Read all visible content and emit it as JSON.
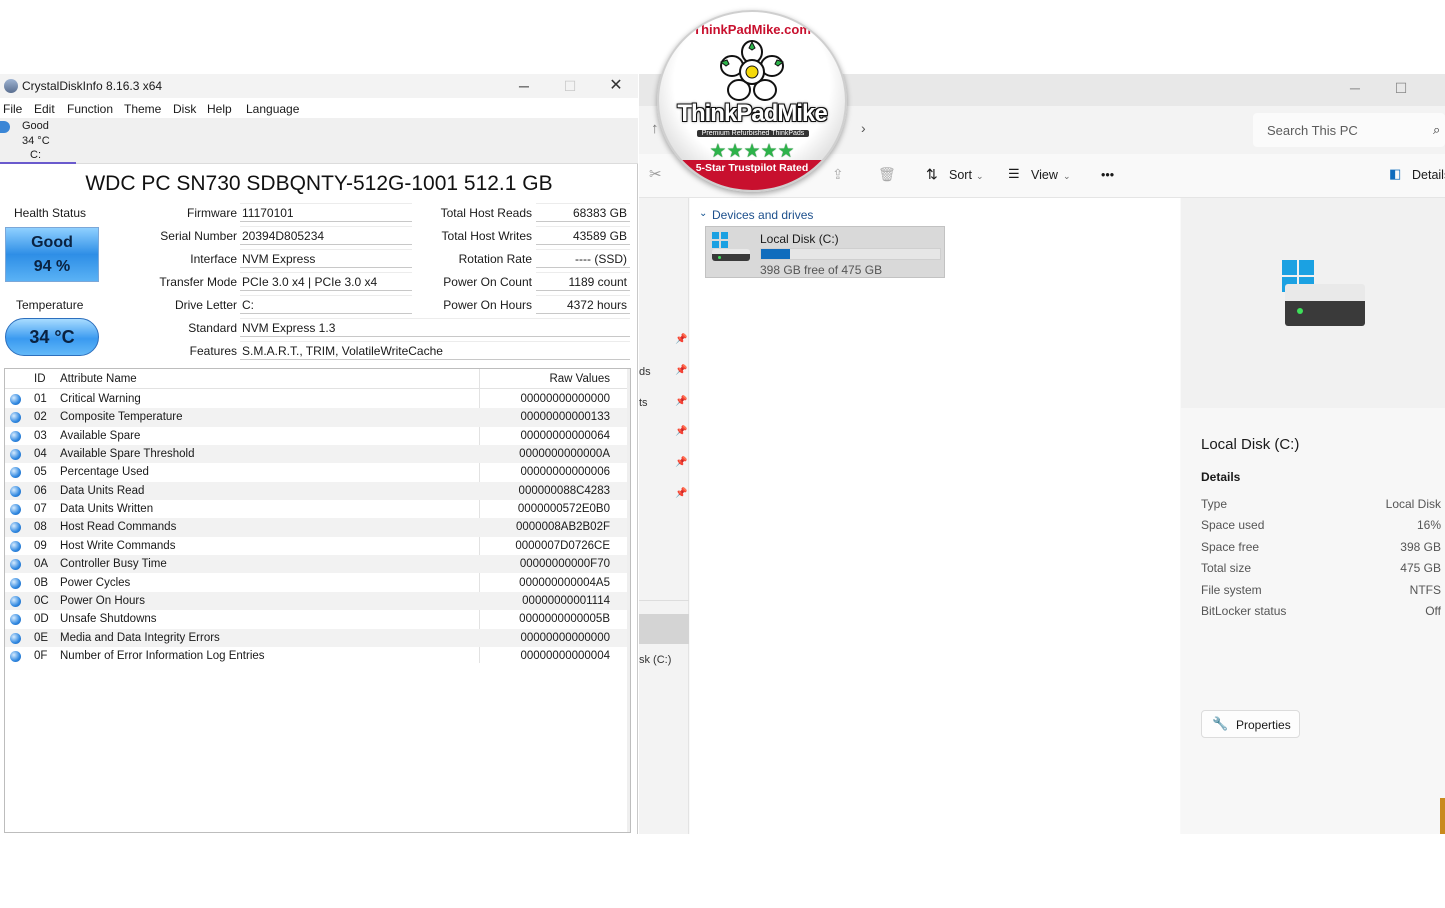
{
  "cdi": {
    "title": "CrystalDiskInfo 8.16.3 x64",
    "menu": [
      "File",
      "Edit",
      "Function",
      "Theme",
      "Disk",
      "Help",
      "Language"
    ],
    "tab": {
      "status": "Good",
      "temp": "34 °C",
      "letter": "C:"
    },
    "drive_title": "WDC PC SN730 SDBQNTY-512G-1001 512.1 GB",
    "health_status_label": "Health Status",
    "health_status": "Good",
    "health_percent": "94 %",
    "temperature_label": "Temperature",
    "temperature": "34 °C",
    "info": {
      "firmware_label": "Firmware",
      "firmware": "11170101",
      "serial_label": "Serial Number",
      "serial": "20394D805234",
      "interface_label": "Interface",
      "interface": "NVM Express",
      "transfer_label": "Transfer Mode",
      "transfer": "PCIe 3.0 x4 | PCIe 3.0 x4",
      "drive_letter_label": "Drive Letter",
      "drive_letter": "C:",
      "standard_label": "Standard",
      "standard": "NVM Express 1.3",
      "features_label": "Features",
      "features": "S.M.A.R.T., TRIM, VolatileWriteCache",
      "total_host_reads_label": "Total Host Reads",
      "total_host_reads": "68383 GB",
      "total_host_writes_label": "Total Host Writes",
      "total_host_writes": "43589 GB",
      "rotation_rate_label": "Rotation Rate",
      "rotation_rate": "---- (SSD)",
      "power_on_count_label": "Power On Count",
      "power_on_count": "1189 count",
      "power_on_hours_label": "Power On Hours",
      "power_on_hours": "4372 hours"
    },
    "attributes_header": {
      "id": "ID",
      "name": "Attribute Name",
      "raw": "Raw Values"
    },
    "attributes": [
      {
        "id": "01",
        "name": "Critical Warning",
        "raw": "00000000000000"
      },
      {
        "id": "02",
        "name": "Composite Temperature",
        "raw": "00000000000133"
      },
      {
        "id": "03",
        "name": "Available Spare",
        "raw": "00000000000064"
      },
      {
        "id": "04",
        "name": "Available Spare Threshold",
        "raw": "0000000000000A"
      },
      {
        "id": "05",
        "name": "Percentage Used",
        "raw": "00000000000006"
      },
      {
        "id": "06",
        "name": "Data Units Read",
        "raw": "000000088C4283"
      },
      {
        "id": "07",
        "name": "Data Units Written",
        "raw": "0000000572E0B0"
      },
      {
        "id": "08",
        "name": "Host Read Commands",
        "raw": "0000008AB2B02F"
      },
      {
        "id": "09",
        "name": "Host Write Commands",
        "raw": "0000007D0726CE"
      },
      {
        "id": "0A",
        "name": "Controller Busy Time",
        "raw": "00000000000F70"
      },
      {
        "id": "0B",
        "name": "Power Cycles",
        "raw": "000000000004A5"
      },
      {
        "id": "0C",
        "name": "Power On Hours",
        "raw": "00000000001114"
      },
      {
        "id": "0D",
        "name": "Unsafe Shutdowns",
        "raw": "0000000000005B"
      },
      {
        "id": "0E",
        "name": "Media and Data Integrity Errors",
        "raw": "00000000000000"
      },
      {
        "id": "0F",
        "name": "Number of Error Information Log Entries",
        "raw": "00000000000004"
      }
    ]
  },
  "explorer": {
    "search_placeholder": "Search This PC",
    "toolbar": {
      "sort": "Sort",
      "view": "View",
      "more": "•••",
      "details": "Details"
    },
    "nav_fragments": [
      "ds",
      "ts",
      "sk (C:)"
    ],
    "section_title": "Devices and drives",
    "drive": {
      "name": "Local Disk (C:)",
      "free": "398 GB free of 475 GB",
      "used_fraction": 0.16
    },
    "details": {
      "title": "Local Disk (C:)",
      "heading": "Details",
      "rows": [
        {
          "k": "Type",
          "v": "Local Disk"
        },
        {
          "k": "Space used",
          "v": "16%"
        },
        {
          "k": "Space free",
          "v": "398 GB"
        },
        {
          "k": "Total size",
          "v": "475 GB"
        },
        {
          "k": "File system",
          "v": "NTFS"
        },
        {
          "k": "BitLocker status",
          "v": "Off"
        }
      ],
      "properties_button": "Properties"
    }
  },
  "badge": {
    "site": "ThinkPadMike.com",
    "brand": "ThinkPadMike",
    "subtitle": "Premium Refurbished ThinkPads",
    "stars": "★★★★★",
    "ribbon": "5-Star Trustpilot Rated"
  },
  "colors": {
    "accent": "#0f6cbd",
    "health_blue": "#2e8ee6",
    "badge_red": "#c8102e",
    "star_green": "#2db34a"
  }
}
